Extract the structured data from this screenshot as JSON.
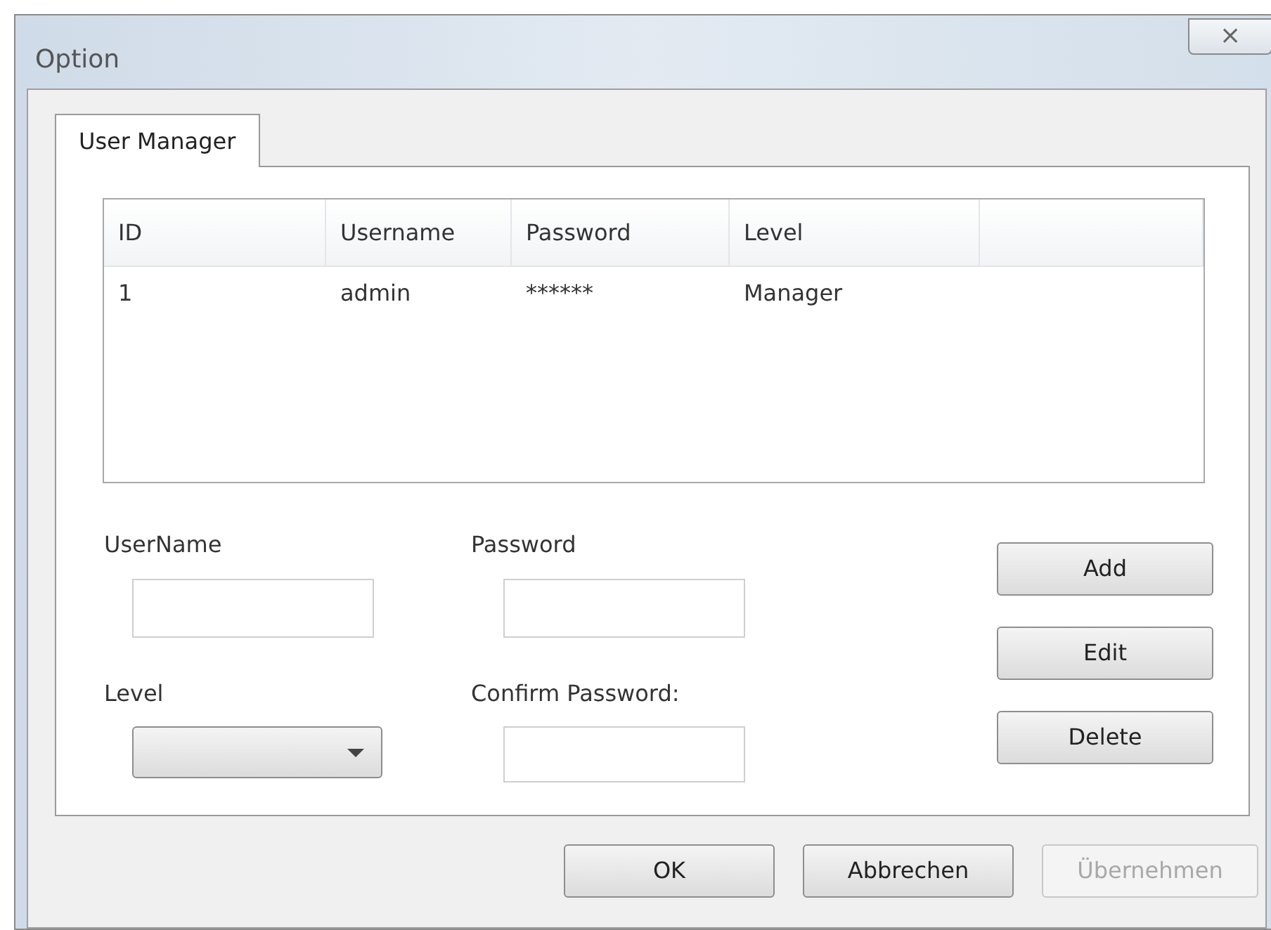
{
  "window": {
    "title": "Option",
    "close": "⨯"
  },
  "tabs": [
    {
      "label": "User Manager",
      "selected": true
    }
  ],
  "table": {
    "columns": [
      "ID",
      "Username",
      "Password",
      "Level"
    ],
    "rows": [
      {
        "cells": [
          "1",
          "admin",
          "******",
          "Manager"
        ],
        "selected": false
      }
    ]
  },
  "form": {
    "username_label": "UserName",
    "password_label": "Password",
    "level_label": "Level",
    "confirm_label": "Confirm Password:"
  },
  "side_buttons": [
    {
      "label": "Add",
      "disabled": false
    },
    {
      "label": "Edit",
      "disabled": false
    },
    {
      "label": "Delete",
      "disabled": false
    }
  ],
  "buttons": [
    {
      "label": "OK",
      "disabled": false
    },
    {
      "label": "Abbrechen",
      "disabled": false
    },
    {
      "label": "Übernehmen",
      "disabled": true
    }
  ]
}
